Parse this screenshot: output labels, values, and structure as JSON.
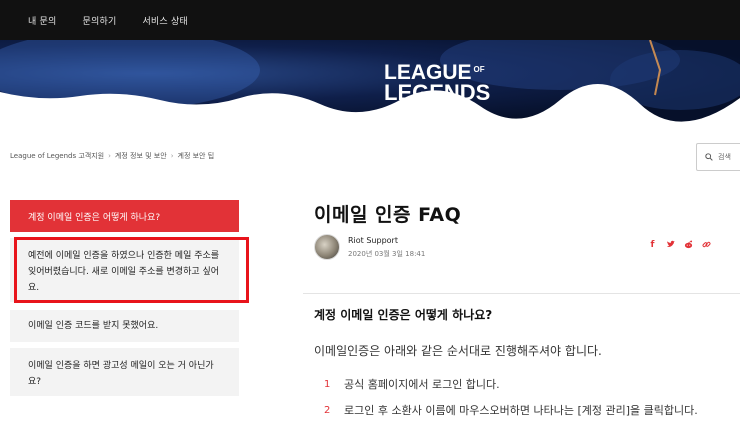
{
  "topnav": {
    "items": [
      "내 문의",
      "문의하기",
      "서비스 상태"
    ]
  },
  "banner": {
    "logo_line1": "LEAGUE",
    "logo_of": "OF",
    "logo_line2": "LEGENDS"
  },
  "breadcrumb": {
    "items": [
      "League of Legends 고객지원",
      "계정 정보 및 보안",
      "계정 보안 팁"
    ],
    "separator": "›"
  },
  "search": {
    "label": "검색"
  },
  "sidebar": {
    "active": "계정 이메일 인증은 어떻게 하나요?",
    "items": [
      "예전에 이메일 인증을 하였으나 인증한 메일 주소를 잊어버렸습니다. 새로 이메일 주소를 변경하고 싶어요.",
      "이메일 인증 코드를 받지 못했어요.",
      "이메일 인증을 하면 광고성 메일이 오는 거 아닌가요?"
    ]
  },
  "article": {
    "title": "이메일 인증 FAQ",
    "author": "Riot Support",
    "date": "2020년 03월 3일 18:41",
    "share_icons": [
      "facebook-icon",
      "twitter-icon",
      "reddit-icon",
      "link-icon"
    ],
    "heading": "계정 이메일 인증은 어떻게 하나요?",
    "intro": "이메일인증은 아래와 같은 순서대로 진행해주셔야 합니다.",
    "steps": [
      {
        "num": "1",
        "text": "공식 홈페이지에서 로그인 합니다."
      },
      {
        "num": "2",
        "text": "로그인 후 소환사 이름에 마우스오버하면 나타나는 [계정 관리]을 클릭합니다."
      }
    ]
  },
  "colors": {
    "accent": "#e23237",
    "nav_bg": "#111111",
    "highlight_box": "#e8141b"
  }
}
